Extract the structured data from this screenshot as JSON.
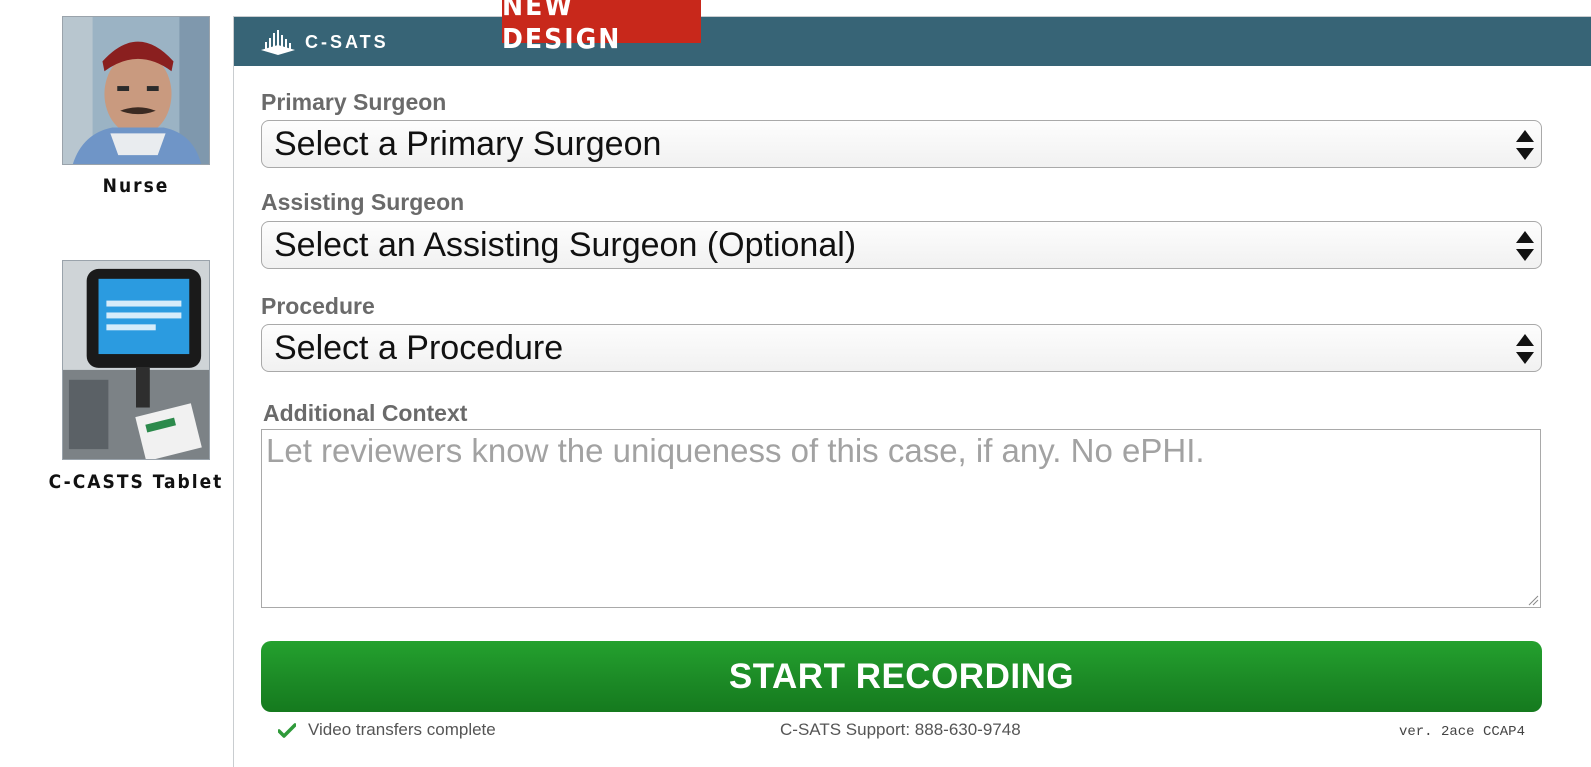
{
  "sidebar": {
    "personas": [
      {
        "caption": "Nurse"
      },
      {
        "caption": "C-CASTS Tablet"
      }
    ]
  },
  "header": {
    "logo_text": "C-SATS",
    "badge_text": "NEW DESIGN",
    "colors": {
      "bar": "#376476",
      "badge": "#c8281b"
    }
  },
  "form": {
    "primary_surgeon": {
      "label": "Primary Surgeon",
      "value": "Select a Primary Surgeon"
    },
    "assisting_surgeon": {
      "label": "Assisting Surgeon",
      "value": "Select an Assisting Surgeon (Optional)"
    },
    "procedure": {
      "label": "Procedure",
      "value": "Select a Procedure"
    },
    "context": {
      "label": "Additional Context",
      "placeholder": "Let reviewers know the uniqueness of this case, if any. No ePHI."
    },
    "start_button": {
      "label": "START RECORDING",
      "color": "#1f8f28"
    }
  },
  "footer": {
    "status_icon": "checkmark-icon",
    "status_text": "Video transfers complete",
    "support_text": "C-SATS Support: 888-630-9748",
    "version_text": "ver. 2ace CCAP4"
  }
}
